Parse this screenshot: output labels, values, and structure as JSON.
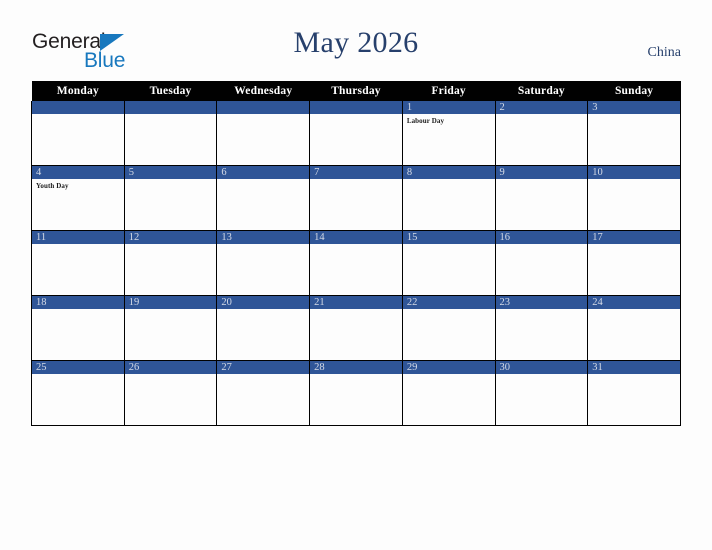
{
  "brand": {
    "logo_word_1": "General",
    "logo_word_2": "Blue",
    "triangle_icon": "triangle-right-icon",
    "color_dark": "#231f20",
    "color_blue": "#1878be"
  },
  "header": {
    "title": "May 2026",
    "country": "China",
    "title_color": "#27406c"
  },
  "calendar": {
    "month": "May",
    "year": "2026",
    "week_start": "Monday",
    "header_bg": "#010101",
    "daybar_bg": "#2f5597",
    "daynum_color": "#d5dbe7",
    "weekdays": [
      "Monday",
      "Tuesday",
      "Wednesday",
      "Thursday",
      "Friday",
      "Saturday",
      "Sunday"
    ],
    "weeks": [
      [
        {
          "day": "",
          "holidays": []
        },
        {
          "day": "",
          "holidays": []
        },
        {
          "day": "",
          "holidays": []
        },
        {
          "day": "",
          "holidays": []
        },
        {
          "day": "1",
          "holidays": [
            "Labour Day"
          ]
        },
        {
          "day": "2",
          "holidays": []
        },
        {
          "day": "3",
          "holidays": []
        }
      ],
      [
        {
          "day": "4",
          "holidays": [
            "Youth Day"
          ]
        },
        {
          "day": "5",
          "holidays": []
        },
        {
          "day": "6",
          "holidays": []
        },
        {
          "day": "7",
          "holidays": []
        },
        {
          "day": "8",
          "holidays": []
        },
        {
          "day": "9",
          "holidays": []
        },
        {
          "day": "10",
          "holidays": []
        }
      ],
      [
        {
          "day": "11",
          "holidays": []
        },
        {
          "day": "12",
          "holidays": []
        },
        {
          "day": "13",
          "holidays": []
        },
        {
          "day": "14",
          "holidays": []
        },
        {
          "day": "15",
          "holidays": []
        },
        {
          "day": "16",
          "holidays": []
        },
        {
          "day": "17",
          "holidays": []
        }
      ],
      [
        {
          "day": "18",
          "holidays": []
        },
        {
          "day": "19",
          "holidays": []
        },
        {
          "day": "20",
          "holidays": []
        },
        {
          "day": "21",
          "holidays": []
        },
        {
          "day": "22",
          "holidays": []
        },
        {
          "day": "23",
          "holidays": []
        },
        {
          "day": "24",
          "holidays": []
        }
      ],
      [
        {
          "day": "25",
          "holidays": []
        },
        {
          "day": "26",
          "holidays": []
        },
        {
          "day": "27",
          "holidays": []
        },
        {
          "day": "28",
          "holidays": []
        },
        {
          "day": "29",
          "holidays": []
        },
        {
          "day": "30",
          "holidays": []
        },
        {
          "day": "31",
          "holidays": []
        }
      ]
    ]
  }
}
